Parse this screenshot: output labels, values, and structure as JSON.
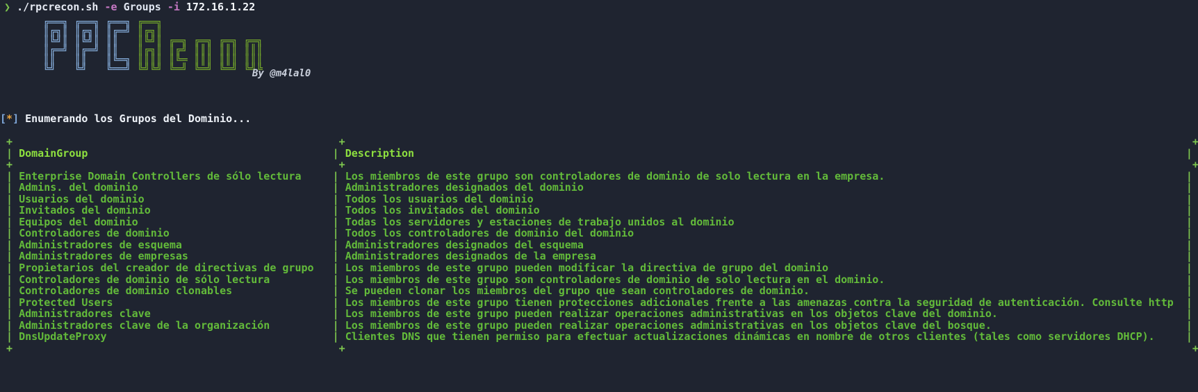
{
  "terminal": {
    "background_color": "#1f2430",
    "border_color": "#7ec74e",
    "header_color": "#8ee03f",
    "cell_color": "#63bb3a",
    "prompt": {
      "caret": "❯",
      "command": "./rpcrecon.sh",
      "flag_e": "-e",
      "arg_e": "Groups",
      "flag_i": "-i",
      "arg_i": "172.16.1.22"
    },
    "banner": {
      "line1": "        __________________                                     ",
      "text_left": "RPC",
      "text_right": "Recon",
      "byline": "By @m4lal0",
      "rows": [
        "┌───┐ ┌───┐ ┌───┐ ┌───┐",
        "│┌┐ │ │┌┐ │ ││   │┌┐ │",
        "│└┘ │ │└┘ │ ││   │└┘ │ ┌─┐ ┌─┐ ┌─┐ ┌─┐",
        "│┌┐┐┘ ││ └─┘ ││   │┌┐┐┘ │││ │┌┘ │││ │││",
        "└┘└┘  └┘     └┘   └┘└┘  └┘┘ └─┘ └─┘ └┘┘"
      ]
    },
    "status_line": {
      "bracket_open": "[",
      "marker": "*",
      "bracket_close": "]",
      "message": "Enumerando los Grupos del Dominio..."
    }
  },
  "table": {
    "columns": [
      "DomainGroup",
      "Description"
    ],
    "col1_width": 52,
    "col2_width": 135,
    "rows": [
      {
        "group": "Enterprise Domain Controllers de sólo lectura",
        "description": "Los miembros de este grupo son controladores de dominio de solo lectura en la empresa."
      },
      {
        "group": "Admins. del dominio",
        "description": "Administradores designados del dominio"
      },
      {
        "group": "Usuarios del dominio",
        "description": "Todos los usuarios del dominio"
      },
      {
        "group": "Invitados del dominio",
        "description": "Todos los invitados del dominio"
      },
      {
        "group": "Equipos del dominio",
        "description": "Todas los servidores y estaciones de trabajo unidos al dominio"
      },
      {
        "group": "Controladores de dominio",
        "description": "Todos los controladores de dominio del dominio"
      },
      {
        "group": "Administradores de esquema",
        "description": "Administradores designados del esquema"
      },
      {
        "group": "Administradores de empresas",
        "description": "Administradores designados de la empresa"
      },
      {
        "group": "Propietarios del creador de directivas de grupo",
        "description": "Los miembros de este grupo pueden modificar la directiva de grupo del dominio"
      },
      {
        "group": "Controladores de dominio de sólo lectura",
        "description": "Los miembros de este grupo son controladores de dominio de solo lectura en el dominio."
      },
      {
        "group": "Controladores de dominio clonables",
        "description": "Se pueden clonar los miembros del grupo que sean controladores de dominio."
      },
      {
        "group": "Protected Users",
        "description": "Los miembros de este grupo tienen protecciones adicionales frente a las amenazas contra la seguridad de autenticación. Consulte http"
      },
      {
        "group": "Administradores clave",
        "description": "Los miembros de este grupo pueden realizar operaciones administrativas en los objetos clave del dominio."
      },
      {
        "group": "Administradores clave de la organización",
        "description": "Los miembros de este grupo pueden realizar operaciones administrativas en los objetos clave del bosque."
      },
      {
        "group": "DnsUpdateProxy",
        "description": "Clientes DNS que tienen permiso para efectuar actualizaciones dinámicas en nombre de otros clientes (tales como servidores DHCP)."
      }
    ]
  }
}
